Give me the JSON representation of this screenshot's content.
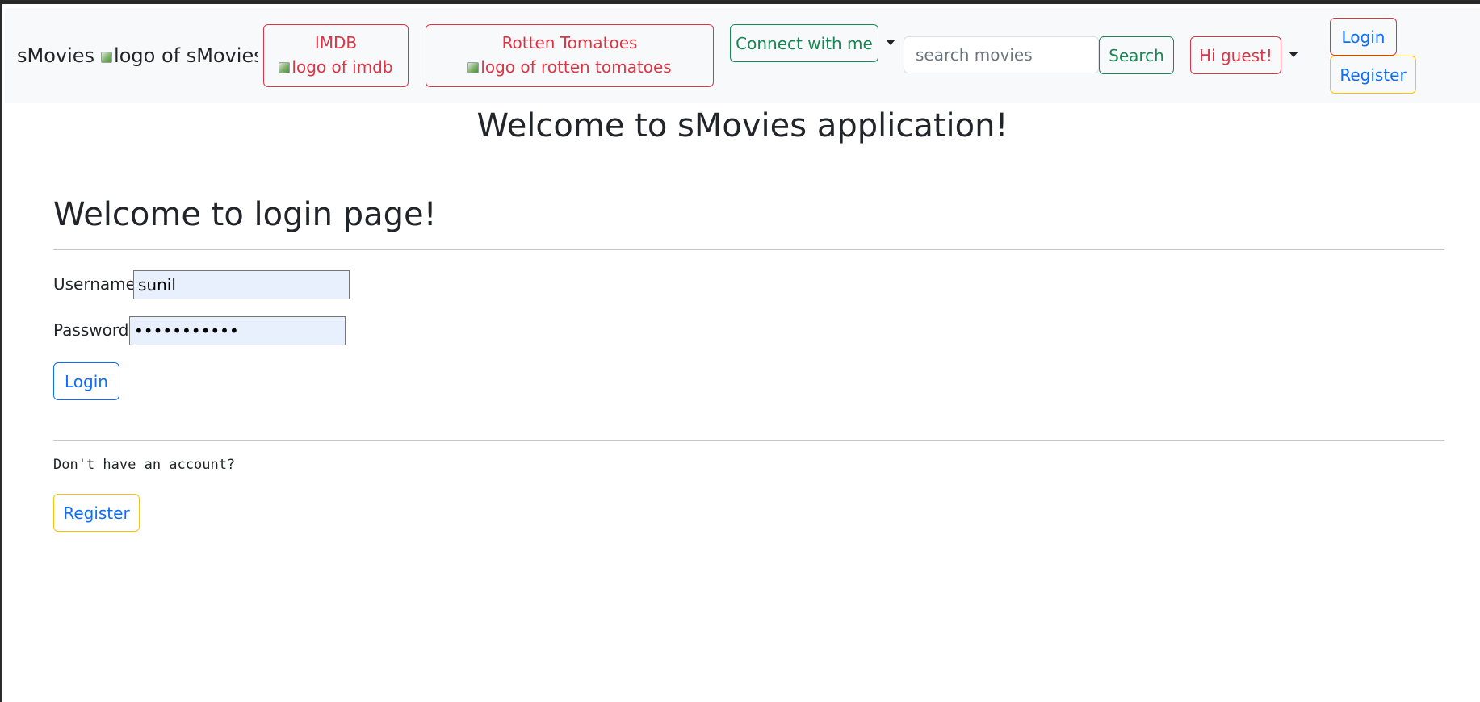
{
  "navbar": {
    "brand_text": "sMovies",
    "brand_logo_alt": "logo of sMovies",
    "imdb": {
      "label": "IMDB",
      "logo_alt": "logo of imdb"
    },
    "rotten_tomatoes": {
      "label": "Rotten Tomatoes",
      "logo_alt": "logo of rotten tomatoes"
    },
    "connect_label": "Connect with me",
    "search": {
      "placeholder": "search movies",
      "value": "",
      "button_label": "Search"
    },
    "greeting_label": "Hi guest!",
    "login_label": "Login",
    "register_label": "Register"
  },
  "main": {
    "app_title": "Welcome to sMovies application!",
    "page_title": "Welcome to login page!",
    "form": {
      "username_label": "Username:",
      "username_value": "sunil",
      "password_label": "Password:",
      "password_value": "sunilpasswd",
      "submit_label": "Login"
    },
    "no_account_text": "Don't have an account?",
    "register_label": "Register"
  },
  "colors": {
    "danger": "#dc3545",
    "success": "#198754",
    "primary": "#0d6efd",
    "warning": "#ffc107",
    "navbar_bg": "#f8f9fa"
  },
  "icons": [
    "broken-image-icon",
    "caret-down-icon"
  ]
}
